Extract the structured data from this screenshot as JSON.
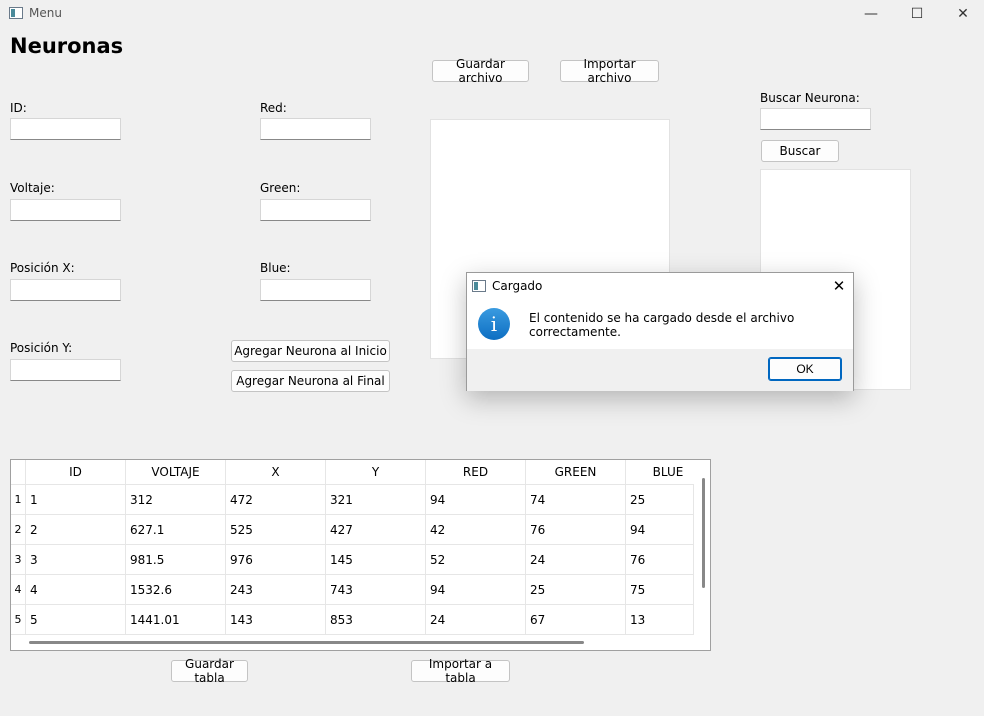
{
  "window": {
    "title": "Menu",
    "minimize": "—",
    "maximize": "☐",
    "close": "✕"
  },
  "main": {
    "heading": "Neuronas",
    "labels": {
      "id": "ID:",
      "voltaje": "Voltaje:",
      "posx": "Posición X:",
      "posy": "Posición Y:",
      "red": "Red:",
      "green": "Green:",
      "blue": "Blue:",
      "buscar_neurona": "Buscar Neurona:"
    },
    "buttons": {
      "guardar_archivo": "Guardar archivo",
      "importar_archivo": "Importar archivo",
      "agregar_inicio": "Agregar Neurona al Inicio",
      "agregar_final": "Agregar Neurona al Final",
      "buscar": "Buscar",
      "guardar_tabla": "Guardar tabla",
      "importar_tabla": "Importar a tabla"
    }
  },
  "table": {
    "columns": [
      "ID",
      "VOLTAJE",
      "X",
      "Y",
      "RED",
      "GREEN",
      "BLUE"
    ],
    "row_headers": [
      "1",
      "2",
      "3",
      "4",
      "5"
    ],
    "rows": [
      [
        "1",
        "312",
        "472",
        "321",
        "94",
        "74",
        "25"
      ],
      [
        "2",
        "627.1",
        "525",
        "427",
        "42",
        "76",
        "94"
      ],
      [
        "3",
        "981.5",
        "976",
        "145",
        "52",
        "24",
        "76"
      ],
      [
        "4",
        "1532.6",
        "243",
        "743",
        "94",
        "25",
        "75"
      ],
      [
        "5",
        "1441.01",
        "143",
        "853",
        "24",
        "67",
        "13"
      ]
    ]
  },
  "dialog": {
    "title": "Cargado",
    "message": "El contenido se ha cargado desde el archivo correctamente.",
    "ok_label": "OK",
    "icon": "information-icon",
    "close": "✕",
    "info_glyph": "i"
  }
}
